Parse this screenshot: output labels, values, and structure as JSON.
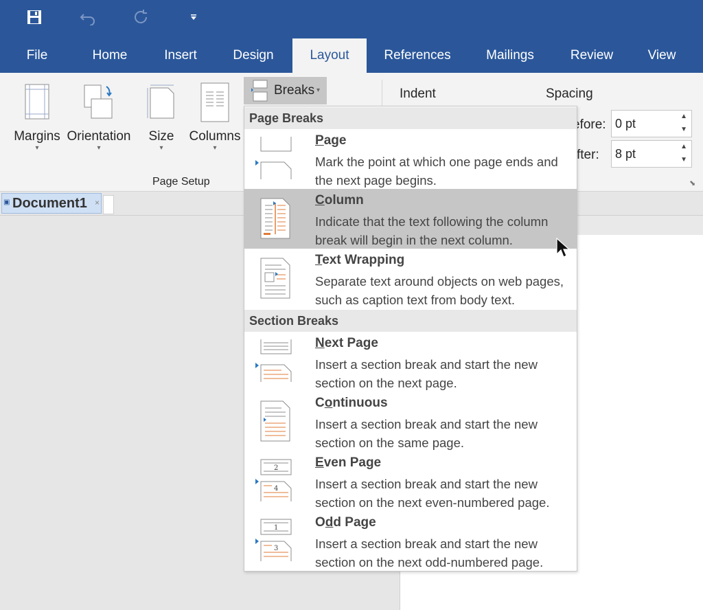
{
  "tabs": [
    "File",
    "Home",
    "Insert",
    "Design",
    "Layout",
    "References",
    "Mailings",
    "Review",
    "View"
  ],
  "active_tab": "Layout",
  "ribbon": {
    "margins": "Margins",
    "orientation": "Orientation",
    "size": "Size",
    "columns": "Columns",
    "breaks": "Breaks",
    "group_label": "Page Setup",
    "indent": "Indent",
    "spacing": "Spacing",
    "before_label": "efore:",
    "after_label": "fter:",
    "before_value": "0 pt",
    "after_value": "8 pt"
  },
  "document_tab": "Document1",
  "menu": {
    "page_breaks_header": "Page Breaks",
    "section_breaks_header": "Section Breaks",
    "items": [
      {
        "key": "P",
        "rest": "age",
        "desc": "Mark the point at which one page ends and the next page begins."
      },
      {
        "key": "C",
        "rest": "olumn",
        "desc": "Indicate that the text following the column break will begin in the next column."
      },
      {
        "key": "T",
        "rest": "ext Wrapping",
        "desc": "Separate text around objects on web pages, such as caption text from body text."
      },
      {
        "key": "N",
        "rest": "ext Page",
        "desc": "Insert a section break and start the new section on the next page."
      },
      {
        "pre": "C",
        "key": "o",
        "rest": "ntinuous",
        "desc": "Insert a section break and start the new section on the same page."
      },
      {
        "key": "E",
        "rest": "ven Page",
        "desc": "Insert a section break and start the new section on the next even-numbered page."
      },
      {
        "pre": "O",
        "key": "d",
        "rest": "d Page",
        "desc": "Insert a section break and start the new section on the next odd-numbered page."
      }
    ],
    "even_numbers": [
      "2",
      "4"
    ],
    "odd_numbers": [
      "1",
      "3"
    ]
  },
  "colors": {
    "brand": "#2b579a",
    "highlight": "#c6c6c6",
    "accent_orange": "#e07b39"
  }
}
